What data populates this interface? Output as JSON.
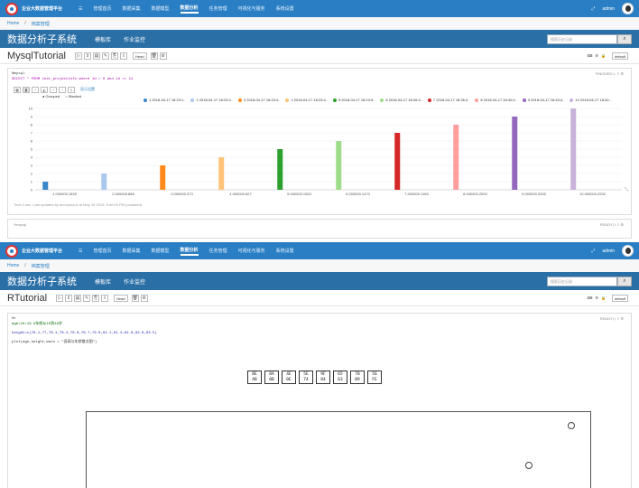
{
  "app": {
    "brand": "企业大数据管理平台",
    "nav": [
      "管理首页",
      "数据采集",
      "数据模型",
      "数据分析",
      "任务管理",
      "可视化与服务",
      "系统设置"
    ],
    "nav_active": "数据分析",
    "user": "admin"
  },
  "breadcrumb": {
    "home": "Home",
    "current": "档案管理"
  },
  "subsystem": {
    "title": "数据分析子系统",
    "menu_db": "模板库",
    "menu_job": "作业监控",
    "search_placeholder": "搜索历史记录"
  },
  "notebook1": {
    "name": "MysqlTutorial",
    "mode": "Head",
    "right_label": "default",
    "paragraph1": {
      "code_lines": [
        "%mysql",
        "SELECT * FROM test_projectinfo where id > 0 and id <= 11"
      ],
      "status": "FINISHED",
      "settings_label": "显示设置",
      "grouped": "Grouped",
      "stacked": "Stacked",
      "footer": "Took 0 sec. Last updated by anonymous at May 19 2019, 8:40:00 PM (outdated)",
      "legend": [
        "1 2018-04-17 18:23:1..",
        "2 2018-04-17 18:23:4..",
        "3 2018-04-17 18:23:4..",
        "4 2018-04-17 18:23:4..",
        "5 2018-04-17 18:23:5..",
        "6 2018-04-17 18:26:4..",
        "7 2018-04-17 18:36:4..",
        "8 2018-04-17 18:40:4..",
        "9 2018-04-17 18:40:4..",
        "10 2018-04-17 18:40:.."
      ]
    },
    "paragraph2": {
      "code": "%mysql",
      "status": "READY"
    }
  },
  "notebook2": {
    "name": "RTutorial",
    "mode": "Head",
    "right_label": "default",
    "paragraph": {
      "status": "READY",
      "code_lines": [
        "%r",
        "age=10:19 #年龄从10到19岁",
        "height=c(76.1,77,78.1,78.2,78.8,79.7,79.9,81.1,81.2,81.8,82.8,83.5)",
        "plot(age,height,main = \"身高与年龄散点图\")"
      ],
      "plot_title_glyphs": [
        "8EAB",
        "8A0B",
        "4E0E",
        "5E74",
        "9F84",
        "6563",
        "70B9",
        "56FE"
      ]
    }
  },
  "chart_data": {
    "type": "bar",
    "categories": [
      "1.000000.1839",
      "2.000000.888",
      "3.000000.373",
      "4.000000.827",
      "5.000000.1553",
      "6.000000.1470",
      "7.000000.1165",
      "8.000000.2592",
      "9.000000.2535",
      "10.000000.2532"
    ],
    "values": [
      1,
      2,
      3,
      4,
      5,
      6,
      7,
      8,
      9,
      10
    ],
    "ylim": [
      0,
      10
    ],
    "yticks": [
      0,
      1,
      2,
      3,
      4,
      5,
      6,
      7,
      8,
      9,
      10
    ],
    "colors": [
      "#3a86c8",
      "#aac8ee",
      "#ff8a1a",
      "#ffc27a",
      "#2ca02c",
      "#9edc8a",
      "#d62728",
      "#ff9e9c",
      "#9467bd",
      "#c8b2dc"
    ]
  }
}
